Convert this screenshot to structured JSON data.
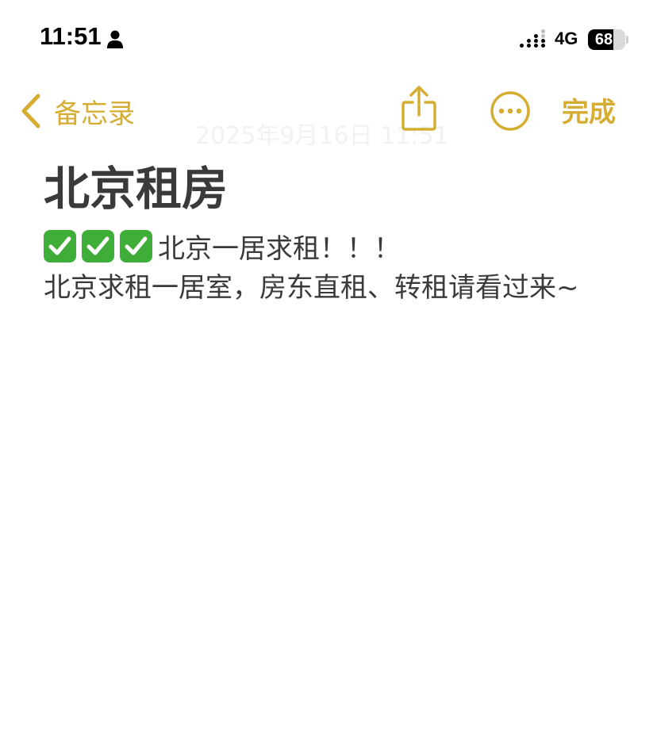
{
  "status_bar": {
    "time": "11:51",
    "network": "4G",
    "battery_percent": "68",
    "battery_level": 0.68
  },
  "nav": {
    "back_label": "备忘录",
    "done_label": "完成",
    "date_stamp": "2025年9月16日 11:51"
  },
  "note": {
    "title": "北京租房",
    "line1_text": "北京一居求租！！！",
    "body": "北京求租一居室，房东直租、转租请看过来~"
  },
  "colors": {
    "accent": "#d6ad33",
    "text": "#3a3a3a",
    "check_green": "#3fae39"
  },
  "icons": {
    "back": "chevron-left-icon",
    "share": "share-icon",
    "more": "ellipsis-circle-icon",
    "check": "check-mark-button-icon",
    "person": "person-icon",
    "signal": "cellular-signal-icon"
  }
}
